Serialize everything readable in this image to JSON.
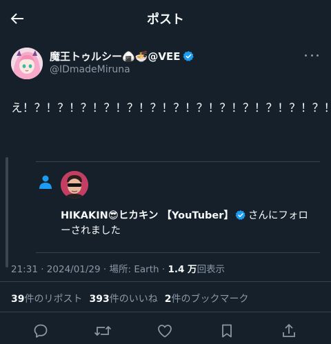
{
  "header": {
    "title": "ポスト",
    "back_icon": "arrow-left-icon"
  },
  "author": {
    "display_name": "魔王トゥルシー🍙🍜@VEE",
    "handle": "@IDmadeMiruna",
    "verified": true,
    "more_icon": "more-horizontal-icon"
  },
  "post": {
    "text": "え！？！？！？！？！？！？！？！？！？！？！？！？！？！？"
  },
  "notification": {
    "icon": "person-icon",
    "name": "HIKAKIN😎ヒカキン 【YouTuber】",
    "verified": true,
    "suffix": "さんにフォローされました"
  },
  "meta": {
    "time": "21:31",
    "date": "2024/01/29",
    "location": "場所: Earth",
    "views_count": "1.4 万",
    "views_label": "回表示",
    "separator": "·"
  },
  "stats": {
    "reposts_count": "39",
    "reposts_label": "件のリポスト",
    "likes_count": "393",
    "likes_label": "件のいいね",
    "bookmarks_count": "2",
    "bookmarks_label": "件のブックマーク"
  },
  "actions": {
    "reply_icon": "reply-icon",
    "repost_icon": "repost-icon",
    "like_icon": "heart-icon",
    "bookmark_icon": "bookmark-icon",
    "share_icon": "share-icon"
  },
  "colors": {
    "background": "#15202b",
    "text": "#f7f9f9",
    "secondary": "#8b98a5",
    "verified": "#1d9bf0",
    "divider": "#38444d"
  }
}
